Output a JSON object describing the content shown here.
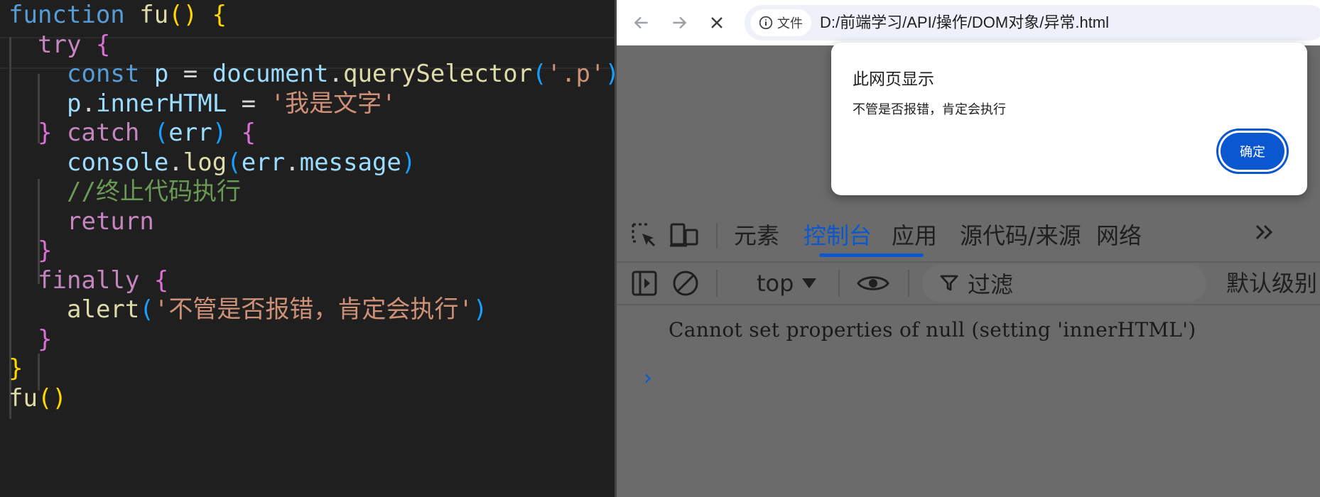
{
  "editor": {
    "lines": [
      [
        [
          "kw",
          "function "
        ],
        [
          "fn",
          "fu"
        ],
        [
          "b1",
          "() {"
        ]
      ],
      [
        [
          "ctl",
          "try "
        ],
        [
          "b2",
          "{"
        ]
      ],
      [
        [
          "kw",
          "const "
        ],
        [
          "var",
          "p "
        ],
        [
          "pl",
          "= "
        ],
        [
          "var",
          "document"
        ],
        [
          "pl",
          "."
        ],
        [
          "fn",
          "querySelector"
        ],
        [
          "b3",
          "("
        ],
        [
          "str",
          "'.p'"
        ],
        [
          "b3",
          ")"
        ]
      ],
      [
        [
          "var",
          "p"
        ],
        [
          "pl",
          "."
        ],
        [
          "var",
          "innerHTML "
        ],
        [
          "pl",
          "= "
        ],
        [
          "str",
          "'我是文字'"
        ]
      ],
      [
        [
          "b2",
          "} "
        ],
        [
          "ctl",
          "catch "
        ],
        [
          "b3",
          "("
        ],
        [
          "var",
          "err"
        ],
        [
          "b3",
          ") "
        ],
        [
          "b2",
          "{"
        ]
      ],
      [
        [
          "var",
          "console"
        ],
        [
          "pl",
          "."
        ],
        [
          "fn",
          "log"
        ],
        [
          "b3",
          "("
        ],
        [
          "var",
          "err"
        ],
        [
          "pl",
          "."
        ],
        [
          "var",
          "message"
        ],
        [
          "b3",
          ")"
        ]
      ],
      [
        [
          "cmt",
          "//终止代码执行"
        ]
      ],
      [
        [
          "ctl",
          "return"
        ]
      ],
      [
        [
          "b2",
          "}"
        ]
      ],
      [
        [
          "ctl",
          "finally "
        ],
        [
          "b2",
          "{"
        ]
      ],
      [
        [
          "fn",
          "alert"
        ],
        [
          "b3",
          "("
        ],
        [
          "str",
          "'不管是否报错，肯定会执行'"
        ],
        [
          "b3",
          ")"
        ]
      ],
      [
        [
          "b2",
          "}"
        ]
      ],
      [
        [
          "b1",
          "}"
        ]
      ],
      [
        [
          "fn",
          "fu"
        ],
        [
          "b1",
          "()"
        ]
      ]
    ]
  },
  "browser": {
    "info_chip_label": "文件",
    "url": "D:/前端学习/API/操作/DOM对象/异常.html",
    "dialog": {
      "title": "此网页显示",
      "message": "不管是否报错，肯定会执行",
      "ok_label": "确定"
    },
    "devtools": {
      "tabs": [
        "元素",
        "控制台",
        "应用",
        "源代码/来源",
        "网络"
      ],
      "active_tab": "控制台",
      "context": "top",
      "filter_placeholder": "过滤",
      "levels_label": "默认级别",
      "console_messages": [
        "Cannot set properties of null (setting 'innerHTML')"
      ],
      "prompt_symbol": "›"
    }
  },
  "colors": {
    "accent": "#0b57d0",
    "editor_bg": "#1f1f1f",
    "devtools_bg": "#6b6b6b"
  }
}
